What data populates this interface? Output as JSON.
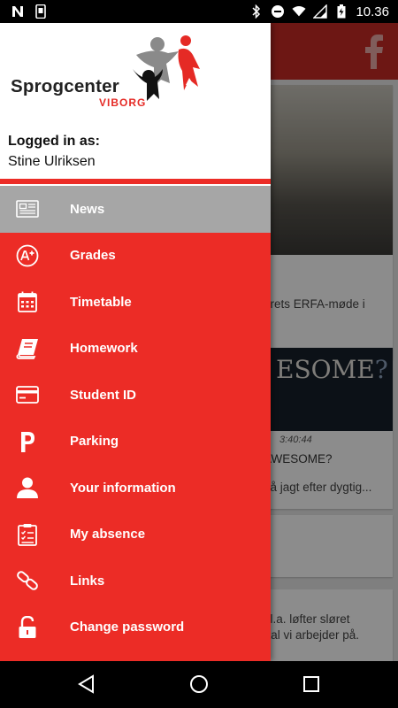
{
  "status_bar": {
    "time": "10.36",
    "icons": [
      "n-icon",
      "phone-icon",
      "bluetooth-icon",
      "do-not-disturb-icon",
      "wifi-icon",
      "signal-icon",
      "battery-charging-icon"
    ]
  },
  "app": {
    "toolbar_color": "#c62b25",
    "facebook_icon": "facebook-icon",
    "cards": [
      {
        "text": "årets ERFA-møde i"
      },
      {
        "overlay_text": "ESOME",
        "overlay_question": "?",
        "video_time": "3:40:44",
        "title": "AWESOME?",
        "text": "på jagt efter dygtig..."
      },
      {
        "text": ""
      },
      {
        "line1": "bl.a. løfter sløret",
        "line2": "rtal vi arbejder på."
      }
    ]
  },
  "drawer": {
    "logo": {
      "name": "Sprogcenter",
      "sub": "VIBORG"
    },
    "logged_in_label": "Logged in as:",
    "user_name": "Stine Ulriksen",
    "accent_color": "#ec2c26",
    "active_color": "#a6a6a6",
    "items": [
      {
        "label": "News",
        "icon": "newspaper-icon",
        "active": true
      },
      {
        "label": "Grades",
        "icon": "grade-a-plus-icon",
        "active": false
      },
      {
        "label": "Timetable",
        "icon": "calendar-icon",
        "active": false
      },
      {
        "label": "Homework",
        "icon": "book-icon",
        "active": false
      },
      {
        "label": "Student ID",
        "icon": "id-card-icon",
        "active": false
      },
      {
        "label": "Parking",
        "icon": "parking-icon",
        "active": false
      },
      {
        "label": "Your information",
        "icon": "user-icon",
        "active": false
      },
      {
        "label": "My absence",
        "icon": "clipboard-checklist-icon",
        "active": false
      },
      {
        "label": "Links",
        "icon": "link-icon",
        "active": false
      },
      {
        "label": "Change password",
        "icon": "unlock-icon",
        "active": false
      }
    ]
  },
  "nav_bar": {
    "buttons": [
      "back-icon",
      "home-icon",
      "recents-icon"
    ]
  }
}
